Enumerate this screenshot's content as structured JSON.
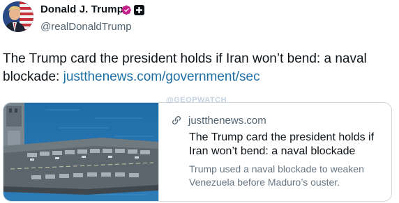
{
  "author": {
    "display_name": "Donald J. Trump",
    "handle": "@realDonaldTrump",
    "avatar_icon": "profile-photo",
    "verified_icon": "verified-badge-icon",
    "verified_color": "#c7218b",
    "affiliate_icon": "affiliate-badge-icon"
  },
  "post": {
    "text": "The Trump card the president holds if Iran won’t bend: a naval blockade: ",
    "link": "justthenews.com/government/sec",
    "link_color": "#1d6fa5"
  },
  "card": {
    "image_icon": "aircraft-carrier-photo",
    "link_icon": "link-icon",
    "domain": "justthenews.com",
    "title": "The Trump card the president holds if Iran won’t bend: a naval blockade",
    "description": "Trump used a naval blockade to weaken Venezuela before Maduro’s ouster."
  },
  "watermark": {
    "text": "@GEOPWATCH"
  }
}
